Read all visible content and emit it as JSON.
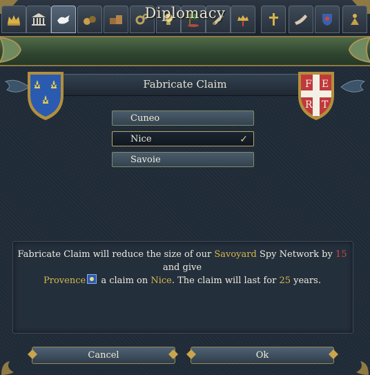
{
  "tabs": [
    {
      "name": "crown-icon",
      "active": false
    },
    {
      "name": "government-building-icon",
      "active": false
    },
    {
      "name": "dove-icon",
      "active": true
    },
    {
      "name": "trade-goods-icon",
      "active": false
    },
    {
      "name": "crates-icon",
      "active": false
    },
    {
      "name": "gears-icon",
      "active": false
    },
    {
      "name": "lightbulb-icon",
      "active": false
    },
    {
      "name": "flag-icon",
      "active": false
    },
    {
      "name": "scroll-icon",
      "active": false
    },
    {
      "name": "crown-sword-icon",
      "active": false
    },
    {
      "name": "cross-icon",
      "active": false
    },
    {
      "name": "horn-icon",
      "active": false
    },
    {
      "name": "crest-icon",
      "active": false
    },
    {
      "name": "idea-tree-icon",
      "active": false
    }
  ],
  "window": {
    "title": "Diplomacy"
  },
  "action": {
    "title": "Fabricate Claim"
  },
  "provinces": [
    {
      "label": "Cuneo",
      "selected": false
    },
    {
      "label": "Nice",
      "selected": true
    },
    {
      "label": "Savoie",
      "selected": false
    }
  ],
  "selected_check": "✓",
  "description": {
    "part1": "Fabricate Claim will reduce the size of our ",
    "spy_country": "Savoyard",
    "part2": " Spy Network by ",
    "spy_cost": "15",
    "part3": " and give",
    "target_country": "Provence",
    "part4": " a claim on ",
    "province": "Nice",
    "part5": ". The claim will last for ",
    "years": "25",
    "part6": " years."
  },
  "buttons": {
    "cancel": "Cancel",
    "ok": "Ok"
  },
  "shields": {
    "left": {
      "field": "#2a5bb0",
      "charge": "#e9cf4a"
    },
    "right": {
      "letters": [
        "F",
        "E",
        "R",
        "T"
      ],
      "field": "#c0393b",
      "cross": "#f3f0e6"
    }
  }
}
